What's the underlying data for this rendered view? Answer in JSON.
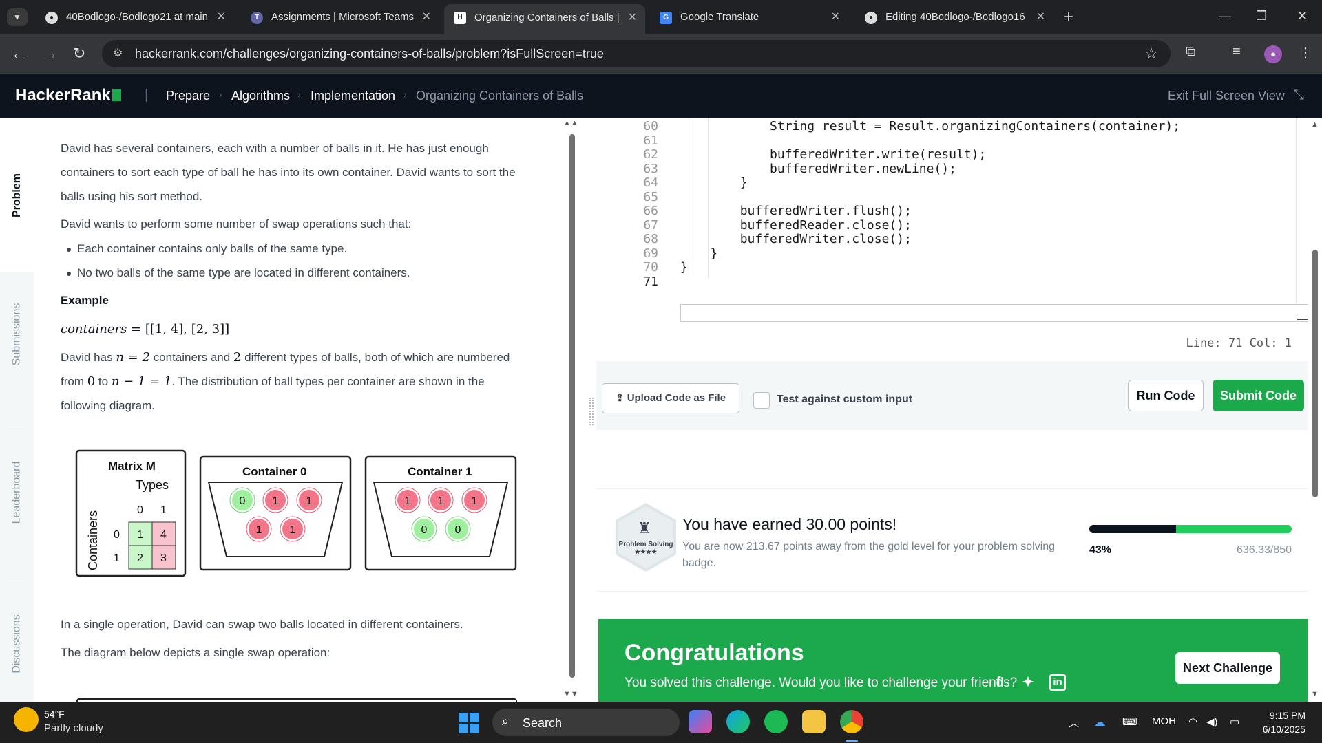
{
  "tabs": [
    {
      "title": "40Bodlogo-/Bodlogo21 at main",
      "icon": "github-icon",
      "active": false
    },
    {
      "title": "Assignments | Microsoft Teams",
      "icon": "teams-icon",
      "active": false
    },
    {
      "title": "Organizing Containers of Balls |",
      "icon": "hackerrank-icon",
      "active": true
    },
    {
      "title": "Google Translate",
      "icon": "google-translate-icon",
      "active": false
    },
    {
      "title": "Editing 40Bodlogo-/Bodlogo16",
      "icon": "github-icon",
      "active": false
    }
  ],
  "address": {
    "url": "hackerrank.com/challenges/organizing-containers-of-balls/problem?isFullScreen=true"
  },
  "header": {
    "logo": "HackerRank",
    "breadcrumb": [
      "Prepare",
      "Algorithms",
      "Implementation"
    ],
    "current": "Organizing Containers of Balls",
    "exit": "Exit Full Screen View"
  },
  "sidebar": {
    "tabs": [
      "Problem",
      "Submissions",
      "Leaderboard",
      "Discussions"
    ]
  },
  "problem": {
    "p1_l1": "David has several containers, each with a number of balls in it. He has just enough",
    "p1_l2": "containers to sort each type of ball he has into its own container. David wants to sort the",
    "p1_l3": "balls using his sort method.",
    "p2": "David wants to perform some number of swap operations such that:",
    "bullets": [
      "Each container contains only balls of the same type.",
      "No two balls of the same type are located in different containers."
    ],
    "example_heading": "Example",
    "example_var": "containers",
    "example_val": "= [[1, 4], [2, 3]]",
    "p3_l1_a": "David has",
    "p3_l1_n": "n = 2",
    "p3_l1_b": "containers and",
    "p3_l1_two": "2",
    "p3_l1_c": "different types of balls, both of which are numbered",
    "p3_l2_a": "from",
    "p3_l2_zero": "0",
    "p3_l2_to": "to",
    "p3_l2_expr": "n − 1 = 1",
    "p3_l2_b": ". The distribution of ball types per container are shown in the",
    "p3_l3": "following diagram.",
    "p4": "In a single operation, David can swap two balls located in different containers.",
    "p5": "The diagram below depicts a single swap operation:"
  },
  "diagram": {
    "matrix_title": "Matrix M",
    "types_label": "Types",
    "containers_label": "Containers",
    "col_labels": [
      "0",
      "1"
    ],
    "row_labels": [
      "0",
      "1"
    ],
    "cells": [
      "1",
      "4",
      "2",
      "3"
    ],
    "container0_title": "Container 0",
    "container0_top": [
      "0",
      "1",
      "1"
    ],
    "container0_bottom": [
      "1",
      "1"
    ],
    "container1_title": "Container 1",
    "container1_top": [
      "1",
      "1",
      "1"
    ],
    "container1_bottom": [
      "0",
      "0"
    ],
    "colors": {
      "type0": "#9ef09e",
      "type1": "#f2758a"
    }
  },
  "code": {
    "lines": [
      {
        "n": "60",
        "text": "            String result = Result.organizingContainers(container);"
      },
      {
        "n": "61",
        "text": ""
      },
      {
        "n": "62",
        "text": "            bufferedWriter.write(result);"
      },
      {
        "n": "63",
        "text": "            bufferedWriter.newLine();"
      },
      {
        "n": "64",
        "text": "        }"
      },
      {
        "n": "65",
        "text": ""
      },
      {
        "n": "66",
        "text": "        bufferedWriter.flush();"
      },
      {
        "n": "67",
        "text": "        bufferedReader.close();"
      },
      {
        "n": "68",
        "text": "        bufferedWriter.close();"
      },
      {
        "n": "69",
        "text": "    }"
      },
      {
        "n": "70",
        "text": "}"
      },
      {
        "n": "71",
        "text": ""
      }
    ],
    "status": "Line: 71 Col: 1"
  },
  "actions": {
    "upload": "Upload Code as File",
    "custom_input": "Test against custom input",
    "run": "Run Code",
    "submit": "Submit Code"
  },
  "earned": {
    "badge_label": "Problem Solving",
    "badge_stars": "★★★★",
    "title": "You have earned 30.00 points!",
    "subtitle": "You are now 213.67 points away from the gold level for your problem solving badge.",
    "progress_fraction": 0.43,
    "percent": "43%",
    "ratio": "636.33/850"
  },
  "congrats": {
    "title": "Congratulations",
    "subtitle": "You solved this challenge. Would you like to challenge your friends?",
    "next": "Next Challenge"
  },
  "taskbar": {
    "temp": "54°F",
    "weather": "Partly cloudy",
    "search": "Search",
    "lang": "MOH",
    "time": "9:15 PM",
    "date": "6/10/2025"
  }
}
